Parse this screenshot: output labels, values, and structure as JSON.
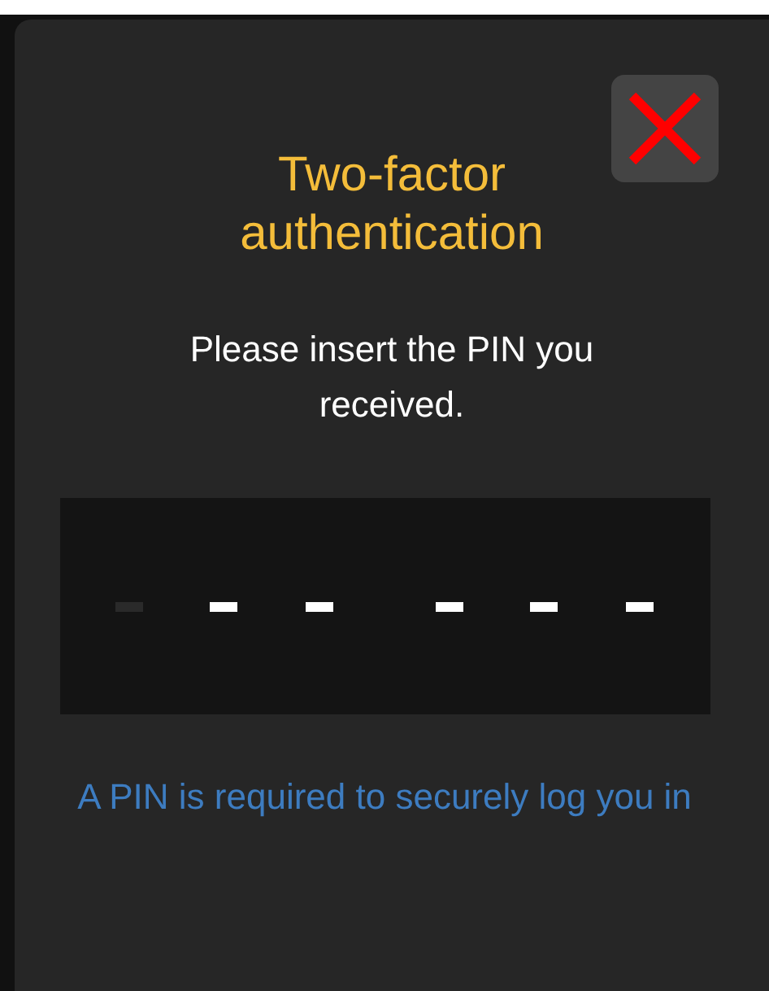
{
  "dialog": {
    "title": "Two-factor authentication",
    "message": "Please insert the PIN you received.",
    "pin_slots": [
      {
        "selected": true
      },
      {
        "selected": false
      },
      {
        "selected": false
      },
      {
        "selected": false
      },
      {
        "selected": false
      },
      {
        "selected": false
      }
    ],
    "hint": "A PIN is required to securely log you in"
  }
}
